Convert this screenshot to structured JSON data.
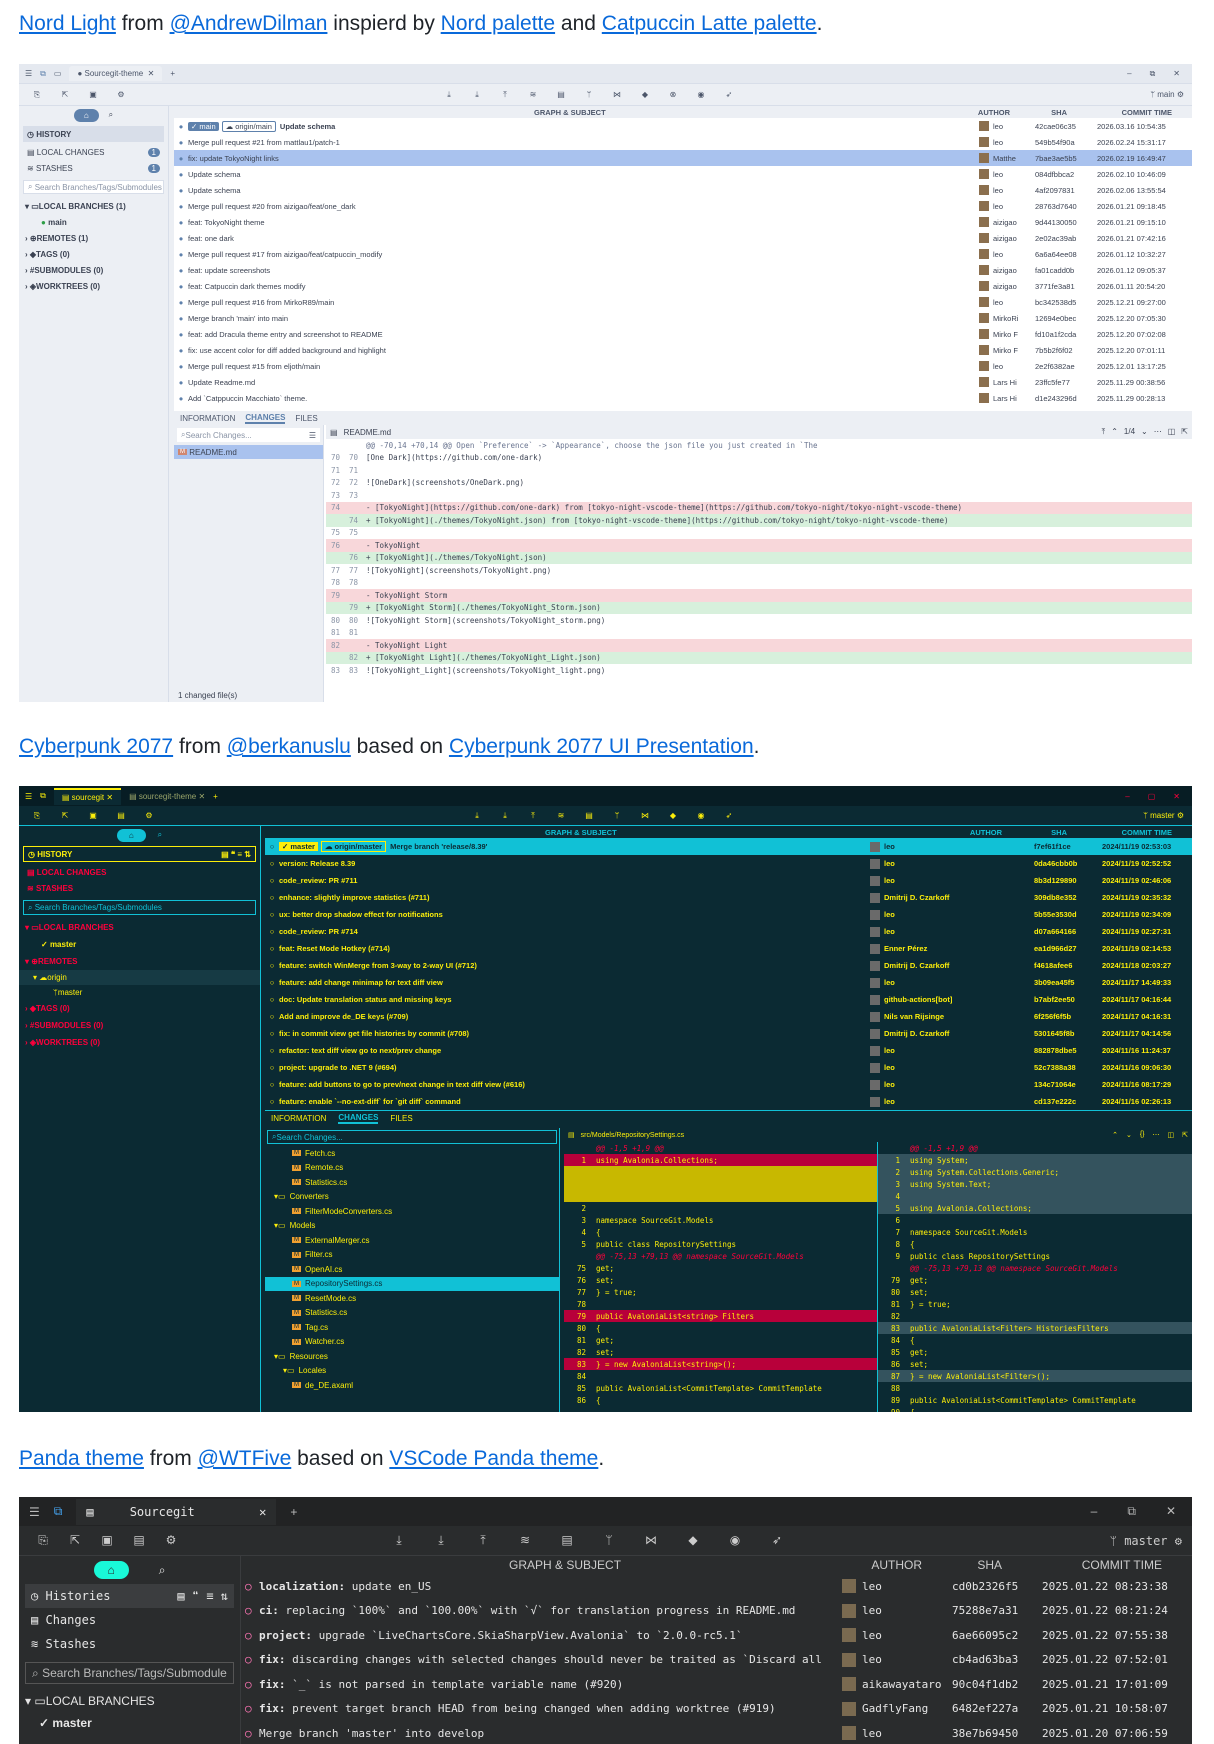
{
  "captions": {
    "light": {
      "theme": "Nord Light",
      "from": " from ",
      "author": "@AndrewDilman",
      "mid": " inspierd by ",
      "link1": "Nord palette",
      "and": " and ",
      "link2": "Catpuccin Latte palette",
      "end": "."
    },
    "cyber": {
      "theme": "Cyberpunk 2077",
      "from": " from ",
      "author": "@berkanuslu",
      "mid": " based on ",
      "link1": "Cyberpunk 2077 UI Presentation",
      "end": "."
    },
    "panda": {
      "theme": "Panda theme",
      "from": " from ",
      "author": "@WTFive",
      "mid": " based on ",
      "link1": "VSCode Panda theme",
      "end": "."
    }
  },
  "light": {
    "tab": "Sourcegit-theme",
    "branch_label": "main",
    "sidebar": {
      "history": "HISTORY",
      "local_changes": "LOCAL CHANGES",
      "local_changes_count": "1",
      "stashes": "STASHES",
      "stashes_count": "1",
      "search_placeholder": "Search Branches/Tags/Submodules",
      "local_branches": "LOCAL BRANCHES (1)",
      "main": "main",
      "remotes": "REMOTES (1)",
      "tags": "TAGS (0)",
      "submodules": "SUBMODULES (0)",
      "worktrees": "WORKTREES (0)"
    },
    "headers": {
      "graph": "GRAPH & SUBJECT",
      "author": "AUTHOR",
      "sha": "SHA",
      "time": "COMMIT TIME"
    },
    "commits": [
      {
        "subject": "Update schema",
        "author": "leo",
        "sha": "42cae06c35",
        "time": "2026.03.16 10:54:35"
      },
      {
        "subject": "Merge pull request #21 from mattlau1/patch-1",
        "author": "leo",
        "sha": "549b54f90a",
        "time": "2026.02.24 15:31:17"
      },
      {
        "subject": "fix: update TokyoNight links",
        "author": "Matthe",
        "sha": "7bae3ae5b5",
        "time": "2026.02.19 16:49:47"
      },
      {
        "subject": "Update schema",
        "author": "leo",
        "sha": "084dfbbca2",
        "time": "2026.02.10 10:46:09"
      },
      {
        "subject": "Update schema",
        "author": "leo",
        "sha": "4af2097831",
        "time": "2026.02.06 13:55:54"
      },
      {
        "subject": "Merge pull request #20 from aizigao/feat/one_dark",
        "author": "leo",
        "sha": "28763d7640",
        "time": "2026.01.21 09:18:45"
      },
      {
        "subject": "feat: TokyoNight theme",
        "author": "aizigao",
        "sha": "9d44130050",
        "time": "2026.01.21 09:15:10"
      },
      {
        "subject": "feat: one dark",
        "author": "aizigao",
        "sha": "2e02ac39ab",
        "time": "2026.01.21 07:42:16"
      },
      {
        "subject": "Merge pull request #17 from aizigao/feat/catpuccin_modify",
        "author": "leo",
        "sha": "6a6a64ee08",
        "time": "2026.01.12 10:32:27"
      },
      {
        "subject": "feat: update screenshots",
        "author": "aizigao",
        "sha": "fa01cadd0b",
        "time": "2026.01.12 09:05:37"
      },
      {
        "subject": "feat: Catpuccin dark themes modify",
        "author": "aizigao",
        "sha": "3771fe3a81",
        "time": "2026.01.11 20:54:20"
      },
      {
        "subject": "Merge pull request #16 from MirkoR89/main",
        "author": "leo",
        "sha": "bc342538d5",
        "time": "2025.12.21 09:27:00"
      },
      {
        "subject": "Merge branch 'main' into main",
        "author": "MirkoRi",
        "sha": "12694e0bec",
        "time": "2025.12.20 07:05:30"
      },
      {
        "subject": "feat: add Dracula theme entry and screenshot to README",
        "author": "Mirko F",
        "sha": "fd10a1f2cda",
        "time": "2025.12.20 07:02:08"
      },
      {
        "subject": "fix: use accent color for diff added background and highlight",
        "author": "Mirko F",
        "sha": "7b5b2f6f02",
        "time": "2025.12.20 07:01:11"
      },
      {
        "subject": "Merge pull request #15 from eljoth/main",
        "author": "leo",
        "sha": "2e2f6382ae",
        "time": "2025.12.01 13:17:25"
      },
      {
        "subject": "Update Readme.md",
        "author": "Lars Hi",
        "sha": "23ffc5fe77",
        "time": "2025.11.29 00:38:56"
      },
      {
        "subject": "Add `Catppuccin Macchiato` theme.",
        "author": "Lars Hi",
        "sha": "d1e243296d",
        "time": "2025.11.29 00:28:13"
      }
    ],
    "tabs": {
      "info": "INFORMATION",
      "changes": "CHANGES",
      "files": "FILES"
    },
    "search_changes": "Search Changes...",
    "file": "README.md",
    "file_header": "README.md",
    "changed_files": "1 changed file(s)",
    "page": "1/4",
    "diff": [
      {
        "o": "",
        "n": "",
        "t": "@@ -70,14 +70,14 @@ Open `Preference` -> `Appearance`, choose the json file you just created in `The",
        "k": "hunk"
      },
      {
        "o": "70",
        "n": "70",
        "t": "[One Dark](https://github.com/one-dark)",
        "k": ""
      },
      {
        "o": "71",
        "n": "71",
        "t": "",
        "k": ""
      },
      {
        "o": "72",
        "n": "72",
        "t": "![OneDark](screenshots/OneDark.png)",
        "k": ""
      },
      {
        "o": "73",
        "n": "73",
        "t": "",
        "k": ""
      },
      {
        "o": "74",
        "n": "",
        "t": "- [TokyoNight](https://github.com/one-dark) from [tokyo-night-vscode-theme](https://github.com/tokyo-night/tokyo-night-vscode-theme)",
        "k": "del"
      },
      {
        "o": "",
        "n": "74",
        "t": "+ [TokyoNight](./themes/TokyoNight.json) from [tokyo-night-vscode-theme](https://github.com/tokyo-night/tokyo-night-vscode-theme)",
        "k": "add"
      },
      {
        "o": "75",
        "n": "75",
        "t": "",
        "k": ""
      },
      {
        "o": "76",
        "n": "",
        "t": "- TokyoNight",
        "k": "del"
      },
      {
        "o": "",
        "n": "76",
        "t": "+ [TokyoNight](./themes/TokyoNight.json)",
        "k": "add"
      },
      {
        "o": "77",
        "n": "77",
        "t": "![TokyoNight](screenshots/TokyoNight.png)",
        "k": ""
      },
      {
        "o": "78",
        "n": "78",
        "t": "",
        "k": ""
      },
      {
        "o": "79",
        "n": "",
        "t": "- TokyoNight Storm",
        "k": "del"
      },
      {
        "o": "",
        "n": "79",
        "t": "+ [TokyoNight Storm](./themes/TokyoNight_Storm.json)",
        "k": "add"
      },
      {
        "o": "80",
        "n": "80",
        "t": "![TokyoNight Storm](screenshots/TokyoNight_storm.png)",
        "k": ""
      },
      {
        "o": "81",
        "n": "81",
        "t": "",
        "k": ""
      },
      {
        "o": "82",
        "n": "",
        "t": "- TokyoNight Light",
        "k": "del"
      },
      {
        "o": "",
        "n": "82",
        "t": "+ [TokyoNight Light](./themes/TokyoNight_Light.json)",
        "k": "add"
      },
      {
        "o": "83",
        "n": "83",
        "t": "![TokyoNight_Light](screenshots/TokyoNight_light.png)",
        "k": ""
      }
    ]
  },
  "cyber": {
    "tab1": "sourcegit",
    "tab2": "sourcegit-theme",
    "branch_label": "master",
    "sidebar": {
      "history": "HISTORY",
      "local_changes": "LOCAL CHANGES",
      "stashes": "STASHES",
      "search_placeholder": "Search Branches/Tags/Submodules",
      "local_branches": "LOCAL BRANCHES",
      "master": "master",
      "remotes": "REMOTES",
      "origin": "origin",
      "origin_master": "master",
      "tags": "TAGS (0)",
      "submodules": "SUBMODULES (0)",
      "worktrees": "WORKTREES (0)"
    },
    "headers": {
      "graph": "GRAPH & SUBJECT",
      "author": "AUTHOR",
      "sha": "SHA",
      "time": "COMMIT TIME"
    },
    "commits": [
      {
        "subject": "Merge branch 'release/8.39'",
        "author": "leo",
        "sha": "f7ef61f1ce",
        "time": "2024/11/19 02:53:03"
      },
      {
        "subject": "version: Release 8.39",
        "author": "leo",
        "sha": "0da46cbb0b",
        "time": "2024/11/19 02:52:52"
      },
      {
        "subject": "code_review: PR #711",
        "author": "leo",
        "sha": "8b3d129890",
        "time": "2024/11/19 02:46:06"
      },
      {
        "subject": "enhance: slightly improve statistics (#711)",
        "author": "Dmitrij D. Czarkoff",
        "sha": "309db8e352",
        "time": "2024/11/19 02:35:32"
      },
      {
        "subject": "ux: better drop shadow effect for notifications",
        "author": "leo",
        "sha": "5b55e3530d",
        "time": "2024/11/19 02:34:09"
      },
      {
        "subject": "code_review: PR #714",
        "author": "leo",
        "sha": "d07a664166",
        "time": "2024/11/19 02:27:31"
      },
      {
        "subject": "feat: Reset Mode Hotkey (#714)",
        "author": "Enner Pérez",
        "sha": "ea1d966d27",
        "time": "2024/11/19 02:14:53"
      },
      {
        "subject": "feature: switch WinMerge from 3-way to 2-way UI (#712)",
        "author": "Dmitrij D. Czarkoff",
        "sha": "f4618afee6",
        "time": "2024/11/18 02:03:27"
      },
      {
        "subject": "feature: add change minimap for text diff view",
        "author": "leo",
        "sha": "3b09ea45f5",
        "time": "2024/11/17 14:49:33"
      },
      {
        "subject": "doc: Update translation status and missing keys",
        "author": "github-actions[bot]",
        "sha": "b7abf2ee50",
        "time": "2024/11/17 04:16:44"
      },
      {
        "subject": "Add and improve de_DE keys (#709)",
        "author": "Nils van Rijsinge",
        "sha": "6f256f6f5b",
        "time": "2024/11/17 04:16:31"
      },
      {
        "subject": "fix: in commit view get file histories by commit (#708)",
        "author": "Dmitrij D. Czarkoff",
        "sha": "5301645f8b",
        "time": "2024/11/17 04:14:56"
      },
      {
        "subject": "refactor: text diff view go to next/prev change",
        "author": "leo",
        "sha": "882878dbe5",
        "time": "2024/11/16 11:24:37"
      },
      {
        "subject": "project: upgrade to .NET 9 (#694)",
        "author": "leo",
        "sha": "52c7388a38",
        "time": "2024/11/16 09:06:30"
      },
      {
        "subject": "feature: add buttons to go to prev/next change in text diff view (#616)",
        "author": "leo",
        "sha": "134c71064e",
        "time": "2024/11/16 08:17:29"
      },
      {
        "subject": "feature: enable `--no-ext-diff` for `git diff` command",
        "author": "leo",
        "sha": "cd137e222c",
        "time": "2024/11/16 02:26:13"
      }
    ],
    "tabs": {
      "info": "INFORMATION",
      "changes": "CHANGES",
      "files": "FILES"
    },
    "search_changes": "Search Changes...",
    "file_header": "src/Models/RepositorySettings.cs",
    "tree": [
      {
        "name": "Fetch.cs",
        "lvl": 3,
        "dir": false
      },
      {
        "name": "Remote.cs",
        "lvl": 3,
        "dir": false
      },
      {
        "name": "Statistics.cs",
        "lvl": 3,
        "dir": false
      },
      {
        "name": "Converters",
        "lvl": 1,
        "dir": true
      },
      {
        "name": "FilterModeConverters.cs",
        "lvl": 3,
        "dir": false
      },
      {
        "name": "Models",
        "lvl": 1,
        "dir": true
      },
      {
        "name": "ExternalMerger.cs",
        "lvl": 3,
        "dir": false
      },
      {
        "name": "Filter.cs",
        "lvl": 3,
        "dir": false
      },
      {
        "name": "OpenAI.cs",
        "lvl": 3,
        "dir": false
      },
      {
        "name": "RepositorySettings.cs",
        "lvl": 3,
        "dir": false
      },
      {
        "name": "ResetMode.cs",
        "lvl": 3,
        "dir": false
      },
      {
        "name": "Statistics.cs",
        "lvl": 3,
        "dir": false
      },
      {
        "name": "Tag.cs",
        "lvl": 3,
        "dir": false
      },
      {
        "name": "Watcher.cs",
        "lvl": 3,
        "dir": false
      },
      {
        "name": "Resources",
        "lvl": 1,
        "dir": true
      },
      {
        "name": "Locales",
        "lvl": 2,
        "dir": true
      },
      {
        "name": "de_DE.axaml",
        "lvl": 3,
        "dir": false
      }
    ],
    "left_diff": [
      {
        "n": "",
        "t": "@@ -1,5 +1,9 @@",
        "k": "hunk"
      },
      {
        "n": "1",
        "t": "using Avalonia.Collections;",
        "k": "del"
      },
      {
        "n": "",
        "t": "",
        "k": "empty"
      },
      {
        "n": "",
        "t": "",
        "k": "empty"
      },
      {
        "n": "",
        "t": "",
        "k": "empty"
      },
      {
        "n": "2",
        "t": "",
        "k": ""
      },
      {
        "n": "3",
        "t": "namespace SourceGit.Models",
        "k": ""
      },
      {
        "n": "4",
        "t": "{",
        "k": ""
      },
      {
        "n": "5",
        "t": "    public class RepositorySettings",
        "k": ""
      },
      {
        "n": "",
        "t": "@@ -75,13 +79,13 @@ namespace SourceGit.Models",
        "k": "hunk"
      },
      {
        "n": "75",
        "t": "            get;",
        "k": ""
      },
      {
        "n": "76",
        "t": "            set;",
        "k": ""
      },
      {
        "n": "77",
        "t": "        } = true;",
        "k": ""
      },
      {
        "n": "78",
        "t": "",
        "k": ""
      },
      {
        "n": "79",
        "t": "        public AvaloniaList<string> Filters",
        "k": "del"
      },
      {
        "n": "80",
        "t": "        {",
        "k": ""
      },
      {
        "n": "81",
        "t": "            get;",
        "k": ""
      },
      {
        "n": "82",
        "t": "            set;",
        "k": ""
      },
      {
        "n": "83",
        "t": "        } = new AvaloniaList<string>();",
        "k": "del"
      },
      {
        "n": "84",
        "t": "",
        "k": ""
      },
      {
        "n": "85",
        "t": "        public AvaloniaList<CommitTemplate> CommitTemplate",
        "k": ""
      },
      {
        "n": "86",
        "t": "        {",
        "k": ""
      }
    ],
    "right_diff": [
      {
        "n": "",
        "t": "@@ -1,5 +1,9 @@",
        "k": "hunk"
      },
      {
        "n": "1",
        "t": "using System;",
        "k": "add"
      },
      {
        "n": "2",
        "t": "using System.Collections.Generic;",
        "k": "add"
      },
      {
        "n": "3",
        "t": "using System.Text;",
        "k": "add"
      },
      {
        "n": "4",
        "t": "",
        "k": "add"
      },
      {
        "n": "5",
        "t": "using Avalonia.Collections;",
        "k": "add"
      },
      {
        "n": "6",
        "t": "",
        "k": ""
      },
      {
        "n": "7",
        "t": "namespace SourceGit.Models",
        "k": ""
      },
      {
        "n": "8",
        "t": "{",
        "k": ""
      },
      {
        "n": "9",
        "t": "    public class RepositorySettings",
        "k": ""
      },
      {
        "n": "",
        "t": "@@ -75,13 +79,13 @@ namespace SourceGit.Models",
        "k": "hunk"
      },
      {
        "n": "79",
        "t": "            get;",
        "k": ""
      },
      {
        "n": "80",
        "t": "            set;",
        "k": ""
      },
      {
        "n": "81",
        "t": "        } = true;",
        "k": ""
      },
      {
        "n": "82",
        "t": "",
        "k": ""
      },
      {
        "n": "83",
        "t": "        public AvaloniaList<Filter> HistoriesFilters",
        "k": "add"
      },
      {
        "n": "84",
        "t": "        {",
        "k": ""
      },
      {
        "n": "85",
        "t": "            get;",
        "k": ""
      },
      {
        "n": "86",
        "t": "            set;",
        "k": ""
      },
      {
        "n": "87",
        "t": "        } = new AvaloniaList<Filter>();",
        "k": "add"
      },
      {
        "n": "88",
        "t": "",
        "k": ""
      },
      {
        "n": "89",
        "t": "        public AvaloniaList<CommitTemplate> CommitTemplate",
        "k": ""
      },
      {
        "n": "90",
        "t": "        {",
        "k": ""
      }
    ]
  },
  "panda": {
    "tab": "Sourcegit",
    "branch_label": "master",
    "sidebar": {
      "histories": "Histories",
      "changes": "Changes",
      "stashes": "Stashes",
      "search_placeholder": "Search Branches/Tags/Submodule",
      "local_branches": "LOCAL BRANCHES",
      "master": "master"
    },
    "headers": {
      "graph": "GRAPH & SUBJECT",
      "author": "AUTHOR",
      "sha": "SHA",
      "time": "COMMIT TIME"
    },
    "commits": [
      {
        "prefix": "localization:",
        "rest": " update en_US",
        "author": "leo",
        "sha": "cd0b2326f5",
        "time": "2025.01.22 08:23:38"
      },
      {
        "prefix": "ci:",
        "rest": " replacing `100%` and `100.00%` with `√` for translation progress in README.md",
        "author": "leo",
        "sha": "75288e7a31",
        "time": "2025.01.22 08:21:24"
      },
      {
        "prefix": "project:",
        "rest": " upgrade `LiveChartsCore.SkiaSharpView.Avalonia` to `2.0.0-rc5.1`",
        "author": "leo",
        "sha": "6ae66095c2",
        "time": "2025.01.22 07:55:38"
      },
      {
        "prefix": "fix:",
        "rest": " discarding changes with selected changes should never be traited as `Discard all",
        "author": "leo",
        "sha": "cb4ad63ba3",
        "time": "2025.01.22 07:52:01"
      },
      {
        "prefix": "fix:",
        "rest": " `_` is not parsed in template variable name (#920)",
        "author": "aikawayataro",
        "sha": "90c04f1db2",
        "time": "2025.01.21 17:01:09"
      },
      {
        "prefix": "fix:",
        "rest": " prevent target branch HEAD from being changed when adding worktree (#919)",
        "author": "GadflyFang",
        "sha": "6482ef227a",
        "time": "2025.01.21 10:58:07"
      },
      {
        "prefix": "",
        "rest": "Merge branch 'master' into develop",
        "author": "leo",
        "sha": "38e7b69450",
        "time": "2025.01.20 07:06:59"
      }
    ]
  },
  "colors": {
    "link": "#0969da",
    "nord_accent": "#5e81ac",
    "cyber_yellow": "#fcee0a",
    "cyber_cyan": "#11c1d6",
    "cyber_red": "#ff003c",
    "panda_bg": "#2a2c2d",
    "panda_green": "#19f9d8"
  }
}
